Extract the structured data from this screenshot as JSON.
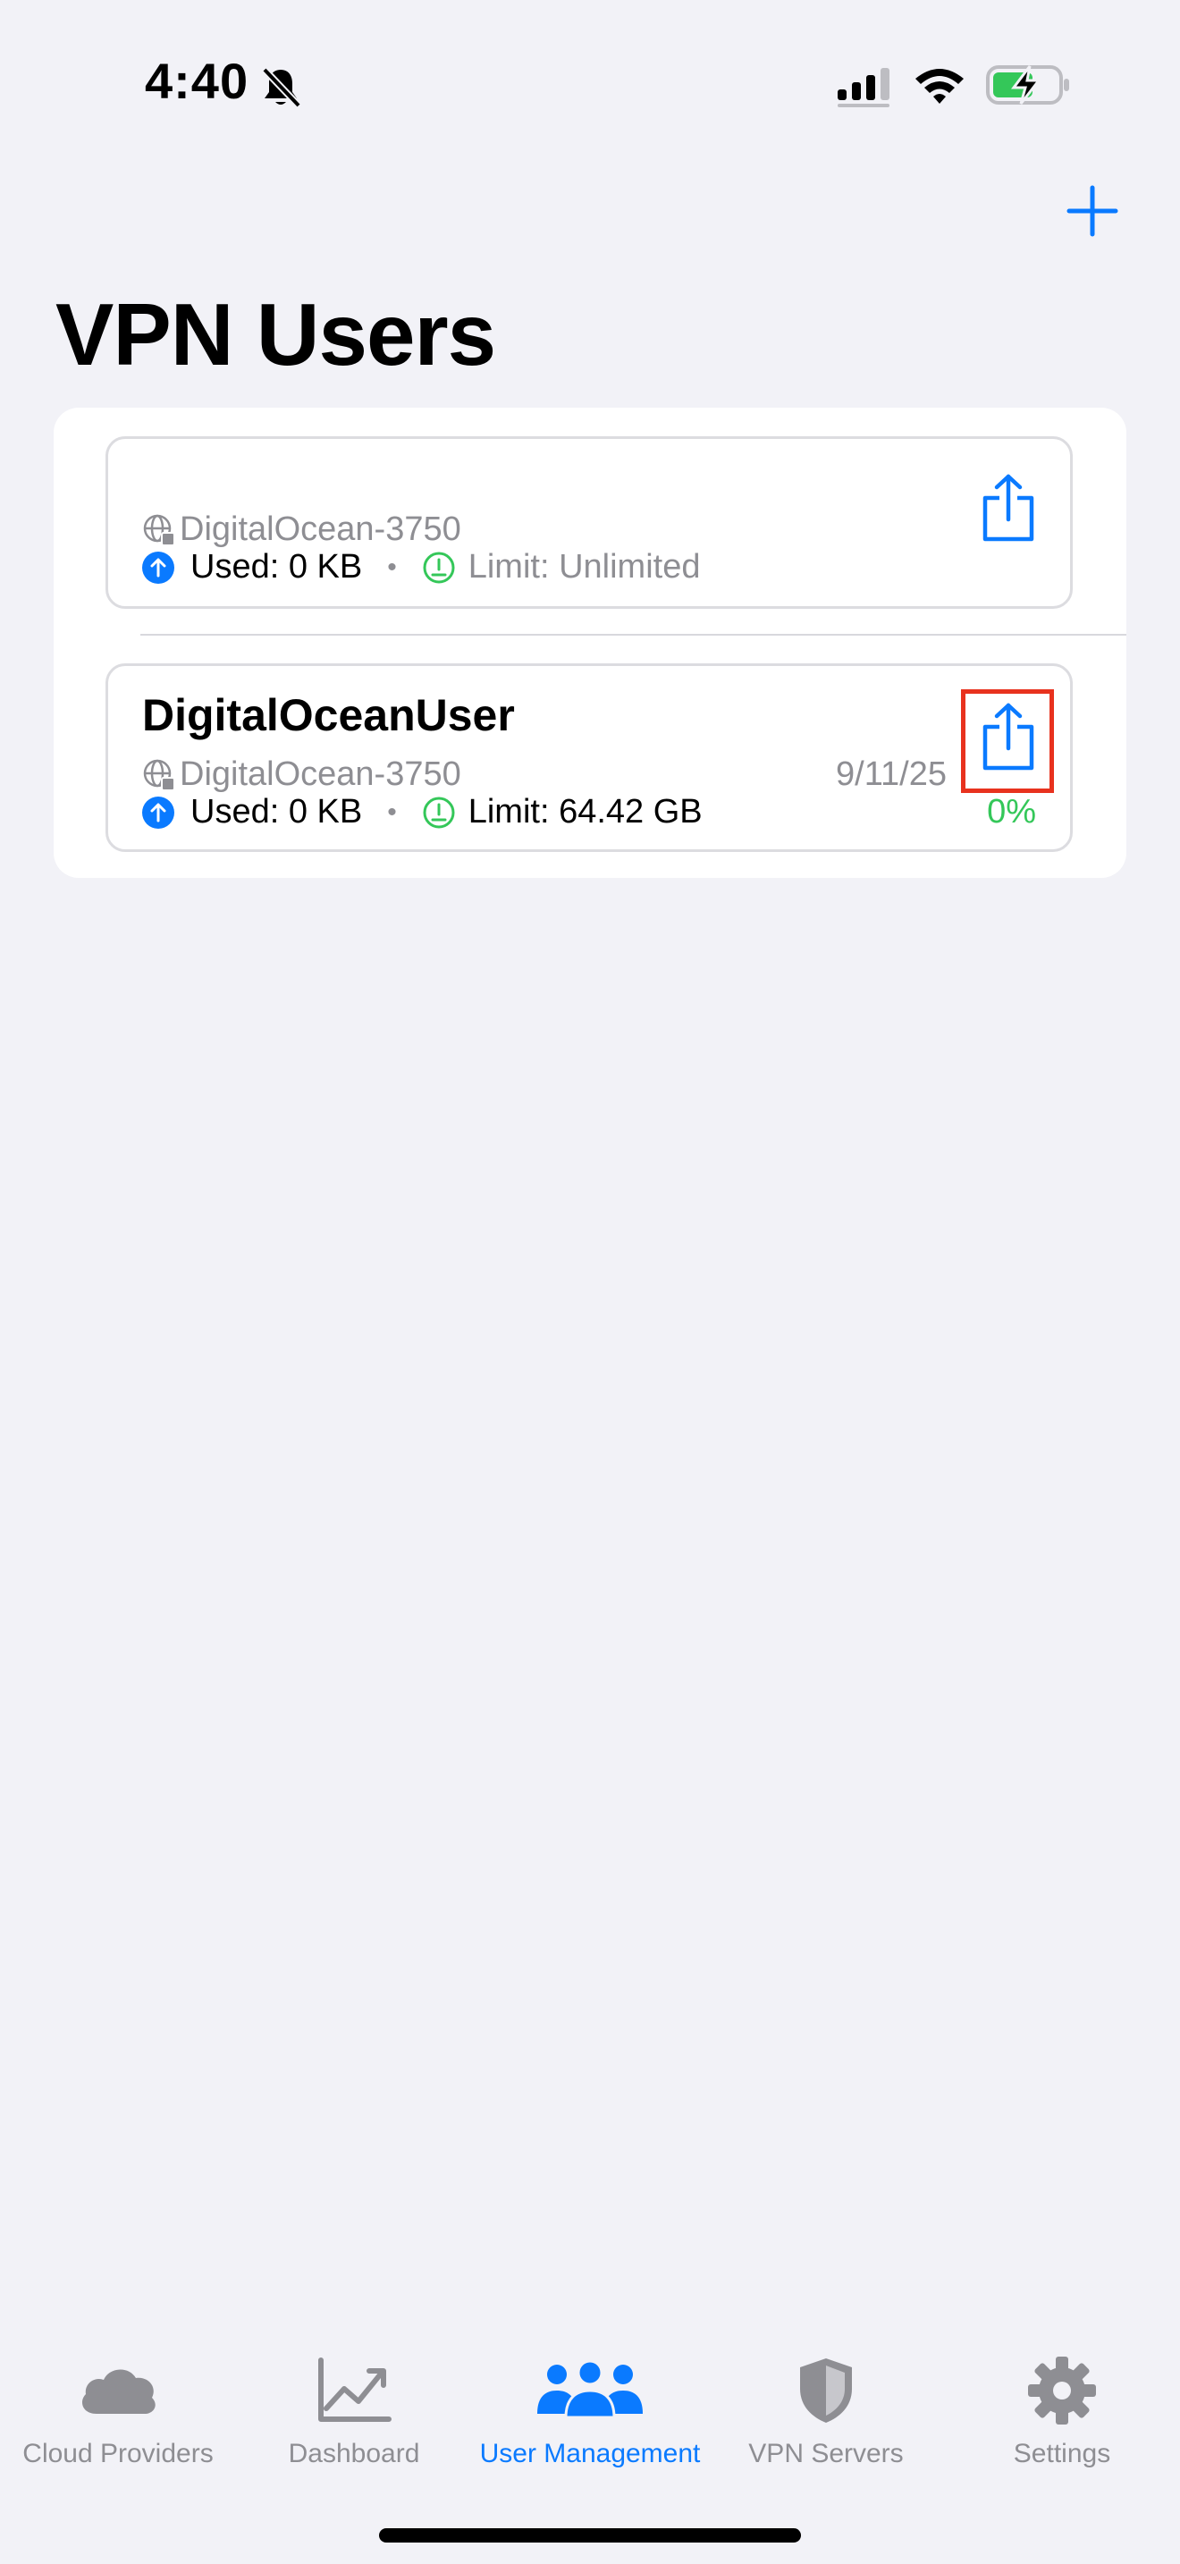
{
  "status_bar": {
    "time": "4:40"
  },
  "header": {
    "title": "VPN Users",
    "add_icon": "plus-icon"
  },
  "colors": {
    "accent": "#0a7aff",
    "success": "#34c759",
    "highlight": "#e8321e"
  },
  "users": [
    {
      "name": "",
      "server": "DigitalOcean-3750",
      "used": "Used: 0 KB",
      "limit": "Limit: Unlimited",
      "date": "",
      "percent": ""
    },
    {
      "name": "DigitalOceanUser",
      "server": "DigitalOcean-3750",
      "used": "Used: 0 KB",
      "limit": "Limit: 64.42 GB",
      "date": "9/11/25",
      "percent": "0%"
    }
  ],
  "separator_dot": "•",
  "tabs": [
    {
      "label": "Cloud Providers",
      "icon": "cloud-icon",
      "active": false
    },
    {
      "label": "Dashboard",
      "icon": "chart-icon",
      "active": false
    },
    {
      "label": "User Management",
      "icon": "people-icon",
      "active": true
    },
    {
      "label": "VPN Servers",
      "icon": "shield-icon",
      "active": false
    },
    {
      "label": "Settings",
      "icon": "gear-icon",
      "active": false
    }
  ]
}
